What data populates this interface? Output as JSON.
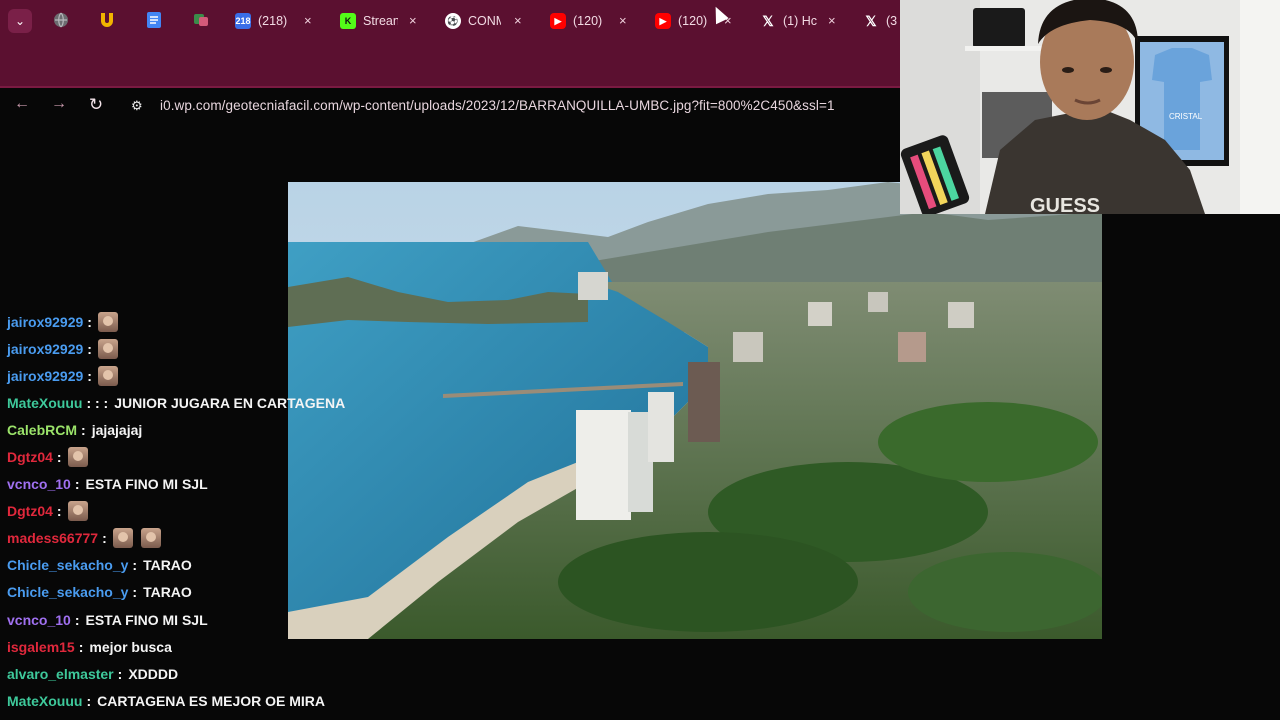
{
  "browser": {
    "tabs": [
      {
        "title": "",
        "icon": "globe-icon"
      },
      {
        "title": "",
        "icon": "u-logo-icon"
      },
      {
        "title": "",
        "icon": "docs-icon"
      },
      {
        "title": "",
        "icon": "app-icon"
      },
      {
        "title": "(218)",
        "icon": "badge-icon",
        "badge": "218"
      },
      {
        "title": "Strean",
        "icon": "kick-icon"
      },
      {
        "title": "CONM",
        "icon": "soccer-ball-icon"
      },
      {
        "title": "(120)",
        "icon": "youtube-icon"
      },
      {
        "title": "(120)",
        "icon": "youtube-icon"
      },
      {
        "title": "(1) Hc",
        "icon": "x-logo-icon"
      },
      {
        "title": "(3",
        "icon": "x-logo-icon"
      }
    ],
    "close_glyph": "×",
    "url": "i0.wp.com/geotecniafacil.com/wp-content/uploads/2023/12/BARRANQUILLA-UMBC.jpg?fit=800%2C450&ssl=1",
    "colors": {
      "chrome": "#5b1030",
      "accent": "#7a1a42"
    }
  },
  "chat": {
    "messages": [
      {
        "user": "jairox92929",
        "color": "#4a9cf0",
        "sep": ":",
        "text": "",
        "emotes": 1
      },
      {
        "user": "jairox92929",
        "color": "#4a9cf0",
        "sep": ":",
        "text": "",
        "emotes": 1
      },
      {
        "user": "jairox92929",
        "color": "#4a9cf0",
        "sep": ":",
        "text": "",
        "emotes": 1
      },
      {
        "user": "MateXouuu",
        "color": "#3ec99b",
        "sep": ": : :",
        "text": "JUNIOR JUGARA EN CARTAGENA",
        "emotes": 0
      },
      {
        "user": "CalebRCM",
        "color": "#9be36a",
        "sep": ":",
        "text": "jajajajaj",
        "emotes": 0
      },
      {
        "user": "Dgtz04",
        "color": "#e0283c",
        "sep": ":",
        "text": "",
        "emotes": 1
      },
      {
        "user": "vcnco_10",
        "color": "#a070f0",
        "sep": ":",
        "text": "ESTA FINO MI SJL",
        "emotes": 0
      },
      {
        "user": "Dgtz04",
        "color": "#e0283c",
        "sep": ":",
        "text": "",
        "emotes": 1
      },
      {
        "user": "madess66777",
        "color": "#e0283c",
        "sep": ":",
        "text": "",
        "emotes": 2
      },
      {
        "user": "Chicle_sekacho_y",
        "color": "#4a9cf0",
        "sep": ":",
        "text": "TARAO",
        "emotes": 0
      },
      {
        "user": "Chicle_sekacho_y",
        "color": "#4a9cf0",
        "sep": ":",
        "text": "TARAO",
        "emotes": 0
      },
      {
        "user": "vcnco_10",
        "color": "#a070f0",
        "sep": ":",
        "text": "ESTA FINO MI SJL",
        "emotes": 0
      },
      {
        "user": "isgalem15",
        "color": "#e0283c",
        "sep": ":",
        "text": "mejor busca",
        "emotes": 0
      },
      {
        "user": "alvaro_elmaster",
        "color": "#3ec99b",
        "sep": ":",
        "text": "XDDDD",
        "emotes": 0
      },
      {
        "user": "MateXouuu",
        "color": "#3ec99b",
        "sep": ":",
        "text": "CARTAGENA ES MEJOR OE MIRA",
        "emotes": 0
      }
    ]
  },
  "webcam": {
    "shirt_text": "GUESS",
    "frame_text": "CRISTAL"
  }
}
